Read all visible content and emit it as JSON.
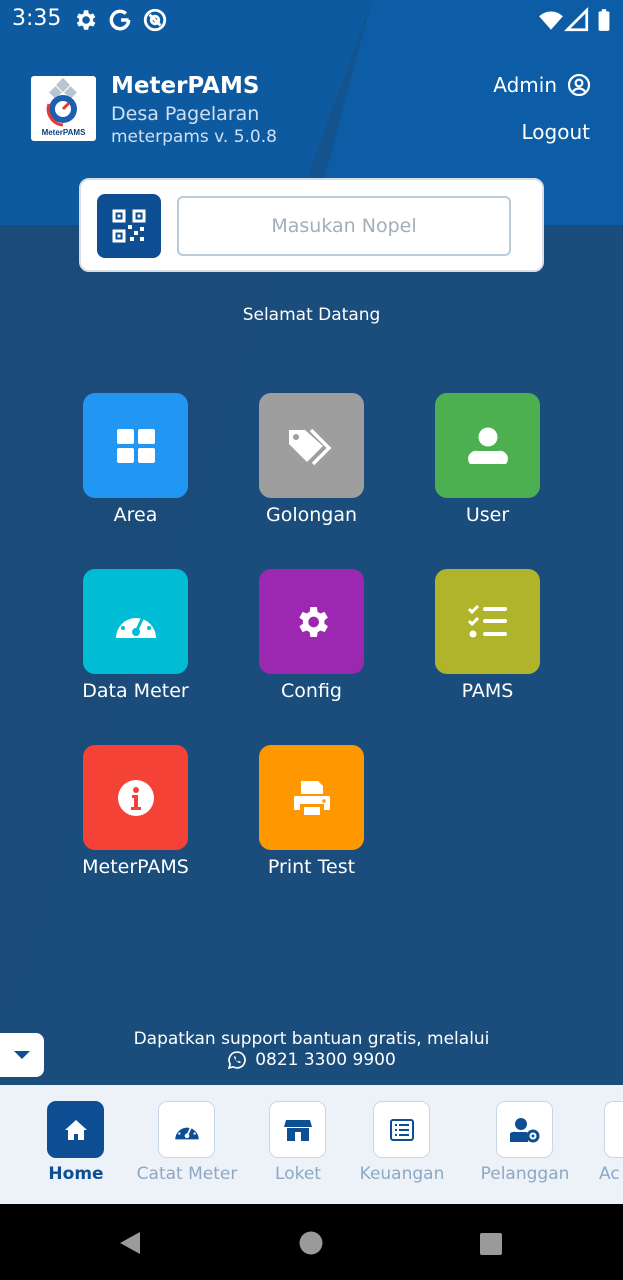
{
  "status_bar": {
    "time": "3:35",
    "icons": [
      "settings-icon",
      "google-icon",
      "at-sign-icon",
      "wifi-icon",
      "signal-icon",
      "battery-icon"
    ]
  },
  "header": {
    "logo_text": "MeterPAMS",
    "app_name": "MeterPAMS",
    "village": "Desa Pagelaran",
    "version": "meterpams v. 5.0.8",
    "user_label": "Admin",
    "logout_label": "Logout"
  },
  "search": {
    "placeholder": "Masukan Nopel",
    "value": ""
  },
  "welcome": "Selamat Datang",
  "menu": [
    {
      "label": "Area",
      "color": "#2196f3",
      "icon": "grid-icon"
    },
    {
      "label": "Golongan",
      "color": "#9e9e9e",
      "icon": "tags-icon"
    },
    {
      "label": "User",
      "color": "#4caf50",
      "icon": "user-icon"
    },
    {
      "label": "Data Meter",
      "color": "#00bcd4",
      "icon": "gauge-icon"
    },
    {
      "label": "Config",
      "color": "#9c27b0",
      "icon": "gear-icon"
    },
    {
      "label": "PAMS",
      "color": "#afb42b",
      "icon": "checklist-icon"
    },
    {
      "label": "MeterPAMS",
      "color": "#f44336",
      "icon": "info-icon"
    },
    {
      "label": "Print Test",
      "color": "#ff9800",
      "icon": "printer-icon"
    }
  ],
  "support": {
    "text": "Dapatkan support bantuan gratis, melalui",
    "phone": "0821 3300 9900"
  },
  "bottom_nav": [
    {
      "label": "Home",
      "active": true,
      "icon": "home-icon"
    },
    {
      "label": "Catat Meter",
      "active": false,
      "icon": "gauge-icon"
    },
    {
      "label": "Loket",
      "active": false,
      "icon": "store-icon"
    },
    {
      "label": "Keuangan",
      "active": false,
      "icon": "receipt-icon"
    },
    {
      "label": "Pelanggan",
      "active": false,
      "icon": "user-cog-icon"
    },
    {
      "label": "Ac",
      "active": false,
      "icon": "account-icon"
    }
  ],
  "colors": {
    "header_blue": "#0d5aa0",
    "body_blue": "#1b4b78",
    "accent": "#0d4f92",
    "nav_bg": "#edf2f8"
  }
}
